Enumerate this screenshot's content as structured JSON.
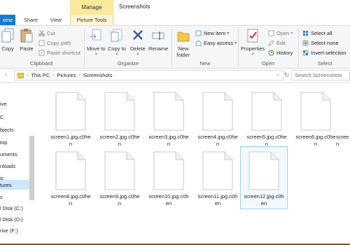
{
  "window": {
    "title": "Screenshots",
    "context_tab": "Manage",
    "context_subtab": "Picture Tools"
  },
  "tabs": [
    "ome",
    "Share",
    "View"
  ],
  "ribbon": {
    "clipboard": {
      "label": "Clipboard",
      "copy": "Copy",
      "paste": "Paste",
      "cut": "Cut",
      "copy_path": "Copy path",
      "paste_shortcut": "Paste shortcut"
    },
    "organize": {
      "label": "Organize",
      "move_to": "Move to",
      "copy_to": "Copy to",
      "delete": "Delete",
      "rename": "Rename"
    },
    "new": {
      "label": "New",
      "new_folder": "New folder",
      "new_item": "New item",
      "easy_access": "Easy access"
    },
    "open": {
      "label": "Open",
      "properties": "Properties",
      "open": "Open",
      "edit": "Edit",
      "history": "History"
    },
    "select": {
      "label": "Select",
      "select_all": "Select all",
      "select_none": "Select none",
      "invert_selection": "Invert selection"
    }
  },
  "address": {
    "crumbs": [
      "This PC",
      "Pictures",
      "Screenshots"
    ],
    "search_placeholder": "Search Screenshots"
  },
  "nav": {
    "items": [
      "ive",
      "C",
      "bjects",
      "top",
      "uments",
      "nloads",
      "ic",
      "tures",
      "s",
      "l Disk (C:)",
      "l Disk (D:)",
      "rive (F:)"
    ],
    "selected_index": 7
  },
  "files": [
    {
      "name": "screen1.jpg.c0hen"
    },
    {
      "name": "screen2.jpg.c0hen"
    },
    {
      "name": "screen3.jpg.c0hen"
    },
    {
      "name": "screen4.jpg.c0hen"
    },
    {
      "name": "screen5.jpg.c0hen"
    },
    {
      "name": "screen6.jpg.c0hen"
    },
    {
      "name": "screen7.jpg.c0hen"
    },
    {
      "name": "screen8.jpg.c0hen"
    },
    {
      "name": "screen9.jpg.c0hen"
    },
    {
      "name": "screen10.jpg.c0hen"
    },
    {
      "name": "screen11.jpg.c0hen"
    },
    {
      "name": "screen12.jpg.c0hen"
    }
  ],
  "files_display": [
    [
      "screen1.jpg.c0he",
      "n"
    ],
    [
      "screen2.jpg.c0he",
      "n"
    ],
    [
      "screen3.jpg.c0he",
      "n"
    ],
    [
      "screen4.jpg.c0he",
      "n"
    ],
    [
      "screen5.jpg.c0he",
      "n"
    ],
    [
      "screen6.jpg.c0he",
      "n"
    ],
    [
      "screen",
      ""
    ],
    [
      "screen8.jpg.c0he",
      "n"
    ],
    [
      "screen9.jpg.c0he",
      "n"
    ],
    [
      "screen10.jpg.c0h",
      "en"
    ],
    [
      "screen11.jpg.c0h",
      "en"
    ],
    [
      "screen12.jpg.c0h",
      "en"
    ]
  ],
  "selected_file_index": 11,
  "colors": {
    "accent": "#1979ca",
    "context_tab": "#f9e99a",
    "selection": "#cce8ff",
    "border_bottom": "#8a5a1e"
  }
}
